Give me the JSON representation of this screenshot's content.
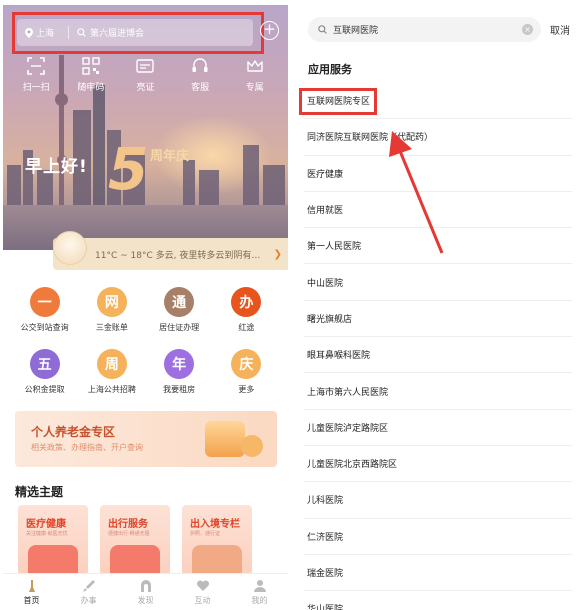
{
  "left": {
    "search": {
      "location": "上海",
      "placeholder": "第六届进博会"
    },
    "top_icons": [
      {
        "label": "扫一扫",
        "icon": "scan-icon"
      },
      {
        "label": "随申码",
        "icon": "qr-code-icon"
      },
      {
        "label": "亮证",
        "icon": "id-card-icon"
      },
      {
        "label": "客服",
        "icon": "headset-icon"
      },
      {
        "label": "专属",
        "icon": "crown-icon"
      }
    ],
    "greeting": "早上好!",
    "anniversary": {
      "number": "5",
      "text": "周年庆"
    },
    "weather": "11°C ~ 18°C  多云, 夜里转多云到阴有…",
    "services": [
      {
        "char": "一",
        "label": "公交到站查询",
        "color": "#f07a3c"
      },
      {
        "char": "网",
        "label": "三金账单",
        "color": "#f6b25a"
      },
      {
        "char": "通",
        "label": "居住证办理",
        "color": "#a8806a"
      },
      {
        "char": "办",
        "label": "红途",
        "color": "#e8541e"
      },
      {
        "char": "五",
        "label": "公积金提取",
        "color": "#8f6bd6"
      },
      {
        "char": "周",
        "label": "上海公共招聘",
        "color": "#f6b25a"
      },
      {
        "char": "年",
        "label": "我要租房",
        "color": "#9d6fe0"
      },
      {
        "char": "庆",
        "label": "更多",
        "color": "#f6b25a"
      }
    ],
    "pension": {
      "title": "个人养老金专区",
      "subtitle": "相关政策、办理指南、开户查询"
    },
    "section_title": "精选主题",
    "cards": [
      {
        "title": "医疗健康",
        "subtitle": "关注健康·就医无忧"
      },
      {
        "title": "出行服务",
        "subtitle": "便捷出行·畅通无阻"
      },
      {
        "title": "出入境专栏",
        "subtitle": "护照、通行证"
      }
    ],
    "tabs": [
      {
        "label": "首页",
        "active": true,
        "icon": "home-icon"
      },
      {
        "label": "办事",
        "active": false,
        "icon": "brush-icon"
      },
      {
        "label": "发现",
        "active": false,
        "icon": "arch-icon"
      },
      {
        "label": "互动",
        "active": false,
        "icon": "heart-icon"
      },
      {
        "label": "我的",
        "active": false,
        "icon": "user-icon"
      }
    ]
  },
  "right": {
    "search_value": "互联网医院",
    "cancel": "取消",
    "section": "应用服务",
    "results": [
      "互联网医院专区",
      "同济医院互联网医院（代配药）",
      "医疗健康",
      "信用就医",
      "第一人民医院",
      "中山医院",
      "曙光旗舰店",
      "眼耳鼻喉科医院",
      "上海市第六人民医院",
      "儿童医院泸定路院区",
      "儿童医院北京西路院区",
      "儿科医院",
      "仁济医院",
      "瑞金医院",
      "华山医院"
    ]
  },
  "colors": {
    "highlight": "#e53935",
    "accent": "#e67e22"
  }
}
